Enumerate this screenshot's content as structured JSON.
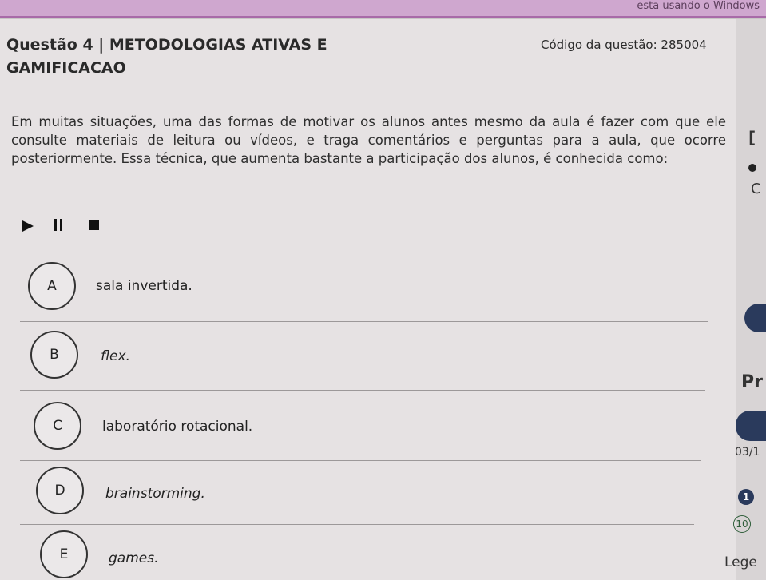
{
  "taskbar": {
    "text": "esta usando o Windows"
  },
  "question": {
    "title": "Questão 4 | METODOLOGIAS ATIVAS E GAMIFICACAO",
    "code": "Código da questão: 285004",
    "text": "Em muitas situações, uma das formas de motivar os alunos antes mesmo da aula é fazer com que ele consulte materiais de leitura ou vídeos, e traga comentários e perguntas para a aula, que ocorre posteriormente. Essa técnica, que aumenta bastante a participação dos alunos, é conhecida como:"
  },
  "media_controls": {
    "play_icon": "play-icon",
    "pause_icon": "pause-icon",
    "stop_icon": "stop-icon"
  },
  "options": [
    {
      "letter": "A",
      "text": "sala invertida."
    },
    {
      "letter": "B",
      "text": "flex."
    },
    {
      "letter": "C",
      "text": "laboratório rotacional."
    },
    {
      "letter": "D",
      "text": "brainstorming."
    },
    {
      "letter": "E",
      "text": "games."
    }
  ],
  "side_panel": {
    "bracket_text": "[",
    "circle_text": "C",
    "heading_partial": "Pr",
    "date_partial": "03/1",
    "badge_number": "1",
    "circle_number": "10",
    "legend_partial": "Lege"
  }
}
